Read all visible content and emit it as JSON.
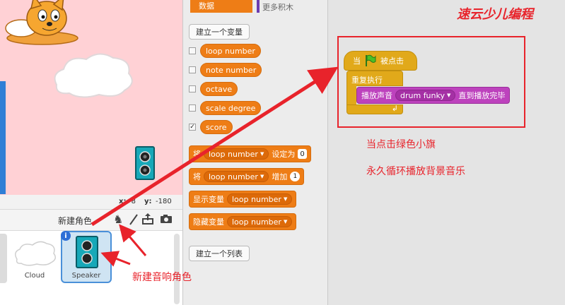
{
  "palette": {
    "category_active": "数据",
    "category_more": "更多积木",
    "make_variable_button": "建立一个变量",
    "variables": [
      {
        "label": "loop number",
        "checked": false
      },
      {
        "label": "note number",
        "checked": false
      },
      {
        "label": "octave",
        "checked": false
      },
      {
        "label": "scale degree",
        "checked": false
      },
      {
        "label": "score",
        "checked": true
      }
    ],
    "set_block": {
      "prefix": "将",
      "var": "loop number",
      "suffix": "设定为",
      "value": "0"
    },
    "change_block": {
      "prefix": "将",
      "var": "loop number",
      "suffix": "增加",
      "value": "1"
    },
    "show_block": {
      "prefix": "显示变量",
      "var": "loop number"
    },
    "hide_block": {
      "prefix": "隐藏变量",
      "var": "loop number"
    },
    "make_list_button": "建立一个列表"
  },
  "stage": {
    "x_label": "x:",
    "x_value": "-8",
    "y_label": "y:",
    "y_value": "-180"
  },
  "sprites": {
    "new_sprite_label": "新建角色",
    "items": [
      {
        "name": "Cloud"
      },
      {
        "name": "Speaker"
      }
    ],
    "info_badge": "i"
  },
  "script": {
    "hat_when": "当",
    "hat_clicked": "被点击",
    "forever": "重复执行",
    "play_sound": "播放声音",
    "sound_name": "drum funky",
    "until_done": "直到播放完毕"
  },
  "annotations": {
    "new_speaker": "新建音响角色",
    "when_flag": "当点击绿色小旗",
    "forever_loop": "永久循环播放背景音乐"
  },
  "watermark": "速云少儿编程",
  "colors": {
    "data_orange": "#ee7d16",
    "sound_purple": "#bd42bd",
    "control_gold": "#e1a91a",
    "annotation_red": "#e8232b"
  }
}
